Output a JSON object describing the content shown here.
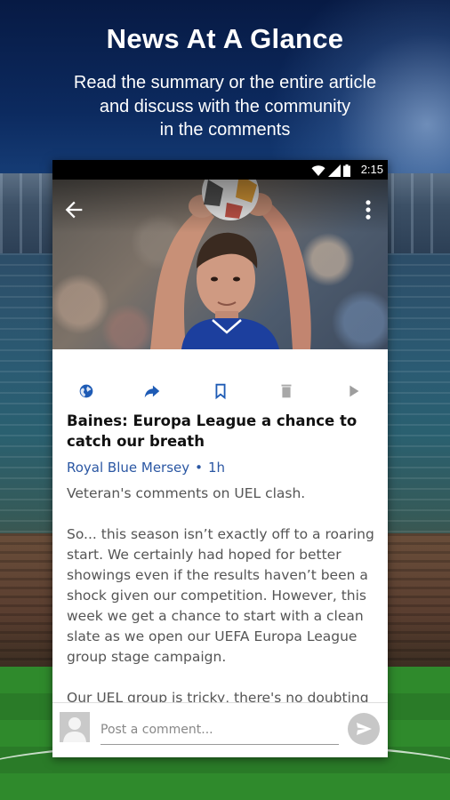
{
  "promo": {
    "title": "News At A Glance",
    "subtitle_lines": [
      "Read the summary or the entire article",
      "and discuss with the community",
      "in the comments"
    ]
  },
  "status_bar": {
    "time": "2:15",
    "icons": [
      "wifi-icon",
      "signal-icon",
      "battery-icon"
    ]
  },
  "toolbar": {
    "icons": [
      "back-arrow-icon",
      "more-vert-icon"
    ]
  },
  "action_bar": {
    "icons": [
      "globe-icon",
      "share-icon",
      "bookmark-icon",
      "delete-icon",
      "play-icon"
    ],
    "active_color": "#1e5bb5",
    "inactive_color": "#9e9e9e"
  },
  "article": {
    "headline": "Baines: Europa League a chance to catch our breath",
    "source": "Royal Blue Mersey",
    "separator": "•",
    "age": "1h",
    "summary": "Veteran's comments on UEL clash.",
    "paragraph": "So... this season isn’t exactly off to a roaring start. We certainly had hoped for better showings even if the results haven’t been a shock given our competition. However, this week we get a chance to start with a clean slate as we open our UEFA Europa League group stage campaign.",
    "paragraph_2": "Our UEL group is tricky, there's no doubting"
  },
  "comment": {
    "placeholder": "Post a comment..."
  },
  "colors": {
    "source_link": "#2b57a3",
    "jersey_blue": "#1c3f9e"
  }
}
